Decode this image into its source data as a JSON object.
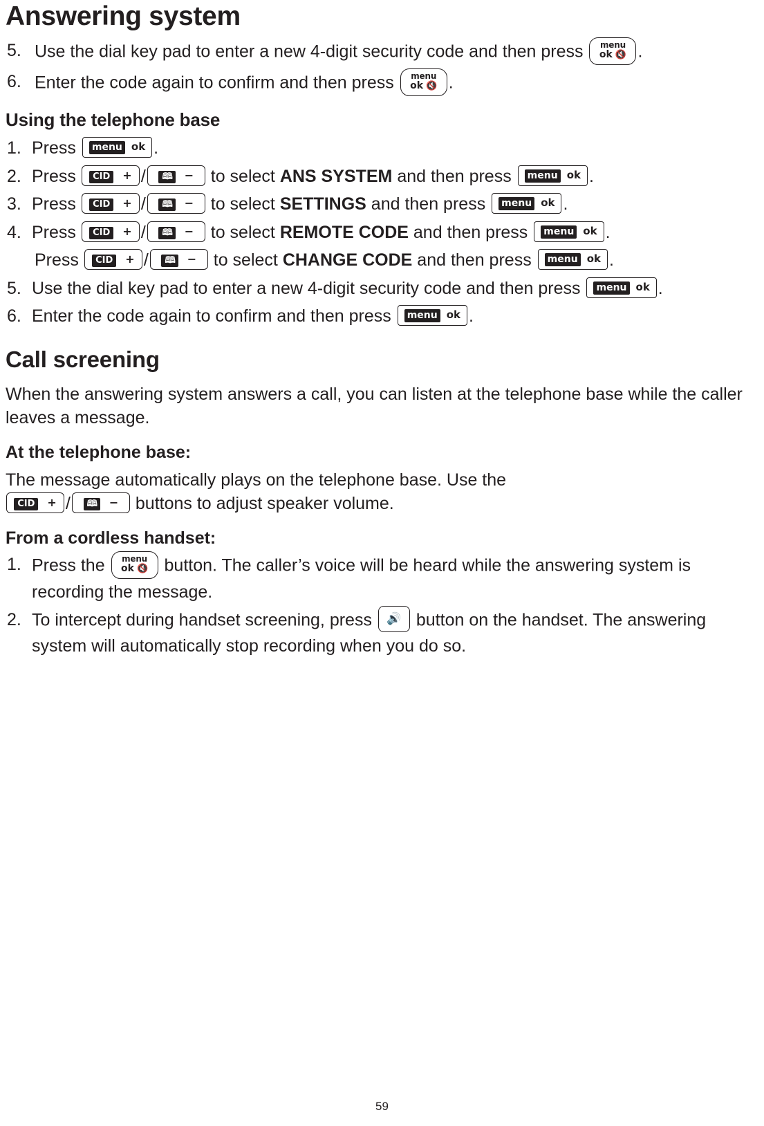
{
  "page": {
    "title": "Answering system",
    "number": "59"
  },
  "keys": {
    "handset_menu_ok": {
      "line1": "menu",
      "line2": "ok",
      "icon": "mic-mute-icon"
    },
    "base_menu_ok": {
      "menu": "menu",
      "ok": "ok"
    },
    "cid_plus": {
      "label": "CID",
      "sign": "+"
    },
    "phonebook_minus": {
      "icon": "phonebook-icon",
      "sign": "−"
    },
    "speaker": {
      "icon": "speaker-icon"
    }
  },
  "top_steps": [
    {
      "num": "5.",
      "parts": [
        {
          "t": "text",
          "v": "Use the dial key pad to enter a new 4-digit security code and then press "
        },
        {
          "t": "key",
          "v": "handset_menu_ok"
        },
        {
          "t": "text",
          "v": "."
        }
      ]
    },
    {
      "num": "6.",
      "parts": [
        {
          "t": "text",
          "v": "Enter the code again to confirm and then press "
        },
        {
          "t": "key",
          "v": "handset_menu_ok"
        },
        {
          "t": "text",
          "v": "."
        }
      ]
    }
  ],
  "using_base": {
    "heading": "Using the telephone base",
    "steps": [
      {
        "num": "1.",
        "press": "Press",
        "select_label": "",
        "trailing": ""
      },
      {
        "num": "2.",
        "press": "Press",
        "to_select": "to select",
        "target": "ANS SYSTEM",
        "and_then": "and then press"
      },
      {
        "num": "3.",
        "press": " Press",
        "to_select": "to select",
        "target": "SETTINGS",
        "and_then": "and then press"
      },
      {
        "num": "4.",
        "press": "Press",
        "to_select": "to select",
        "target": "REMOTE CODE",
        "and_then": "and then press"
      },
      {
        "num": "",
        "press": "Press",
        "to_select": "to select",
        "target": "CHANGE CODE",
        "and_then": "and then press"
      },
      {
        "num": "5.",
        "text_a": "Use the dial key pad to enter a new 4-digit security code and then press",
        "text_b": "."
      },
      {
        "num": "6.",
        "text_a": "Enter the code again to confirm and then press",
        "text_b": "."
      }
    ]
  },
  "call_screening": {
    "heading": "Call screening",
    "intro": "When the answering system answers a call, you can listen at the telephone base while the caller leaves a message.",
    "at_base_heading": "At the telephone base:",
    "at_base_text_a": "The message automatically plays on the telephone base. Use the",
    "at_base_text_b": "buttons to adjust speaker volume.",
    "from_handset_heading": "From a cordless handset:",
    "handset_steps": [
      {
        "num": "1.",
        "text_a": "Press the",
        "text_b": "button. The caller’s voice will be heard while the answering system is recording the message."
      },
      {
        "num": "2.",
        "text_a": "To intercept during handset screening, press",
        "text_b": "button on the handset. The answering system will automatically stop recording when you do so."
      }
    ]
  }
}
